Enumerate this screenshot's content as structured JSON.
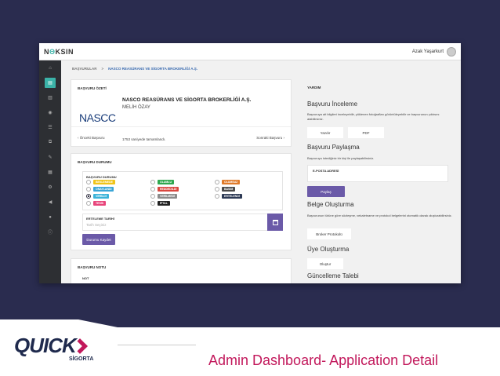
{
  "topbar": {
    "logo_pre": "N",
    "logo_accent": "Θ",
    "logo_post": "KSIN",
    "user_name": "Azak Yaşarkurt"
  },
  "breadcrumb": {
    "root": "BAŞVURULAR",
    "sep": ">",
    "current": "NASCO REASÜRANS VE SİGORTA BROKERLİĞİ A.Ş."
  },
  "summary": {
    "title": "BAŞVURU ÖZETİ",
    "logo_text": "NASCC",
    "company": "NASCO REASÜRANS VE SİGORTA BROKERLİĞİ A.Ş.",
    "person": "MELİH ÖZAY",
    "time": "1753 saniyede tamamlandı.",
    "prev": "‹  Önceki Başvuru",
    "next": "Sonraki Başvuru  ›"
  },
  "status": {
    "title": "BAŞVURU DURUMU",
    "subtitle": "BAŞVURU DURUMU",
    "options": [
      {
        "label": "BEKLEMEDE",
        "color": "#f0c419",
        "checked": false
      },
      {
        "label": "OLUMLU",
        "color": "#2fa84f",
        "checked": false
      },
      {
        "label": "OLUMSUZ",
        "color": "#e07b2a",
        "checked": false
      },
      {
        "label": "ONAYLANDI",
        "color": "#3aa5d6",
        "checked": false
      },
      {
        "label": "REDDEDİLDİ",
        "color": "#d9473f",
        "checked": false
      },
      {
        "label": "BASIM",
        "color": "#4a4a4a",
        "checked": false
      },
      {
        "label": "VERİLDİ",
        "color": "#3bb3d9",
        "checked": true
      },
      {
        "label": "VERİLMEDİ",
        "color": "#8b8b8b",
        "checked": false
      },
      {
        "label": "ERTELENDİ",
        "color": "#2d3a55",
        "checked": false
      },
      {
        "label": "TESİS",
        "color": "#e8457b",
        "checked": false
      },
      {
        "label": "İPTAL",
        "color": "#222222",
        "checked": false
      }
    ],
    "date_label": "ERTELEME TARİHİ",
    "date_placeholder": "Tarih Seçiniz",
    "save_label": "Durumu Kaydet"
  },
  "note": {
    "title": "BAŞVURU NOTU",
    "field_label": "NOT"
  },
  "help": {
    "title": "YARDIM",
    "inspect_heading": "Başvuru İnceleme",
    "inspect_desc": "Başvuruya ait bilgileri inceleyebilir, yüklenen fotoğrafları görüntüleyebilir ve başvurunun çıktısını alabilirsiniz.",
    "print_label": "Yazdır",
    "pdf_label": "PDF",
    "share_heading": "Başvuru Paylaşma",
    "share_desc": "Başvuruyu istediğiniz bir kişi ile paylaşabilirsiniz.",
    "email_label": "E-POSTA ADRESİ",
    "share_button": "Paylaş",
    "doc_heading": "Belge Oluşturma",
    "doc_desc": "Başvurunun türüne göre sözleşme, vekaletname ve protokol belgelerini otomatik olarak oluşturabilirsiniz.",
    "broker_button": "Broker Protokolü",
    "member_heading": "Üye Oluşturma",
    "member_button": "Oluştur",
    "update_heading": "Güncelleme Talebi"
  },
  "footer": {
    "brand": "QUICK",
    "brand_sub": "SİGORTA",
    "caption": "Admin Dashboard- Application Detail"
  },
  "colors": {
    "accent": "#6b5aa8",
    "teal": "#3bb3a8",
    "brand_pink": "#c2185b",
    "dark_bg": "#2a2c4f"
  }
}
